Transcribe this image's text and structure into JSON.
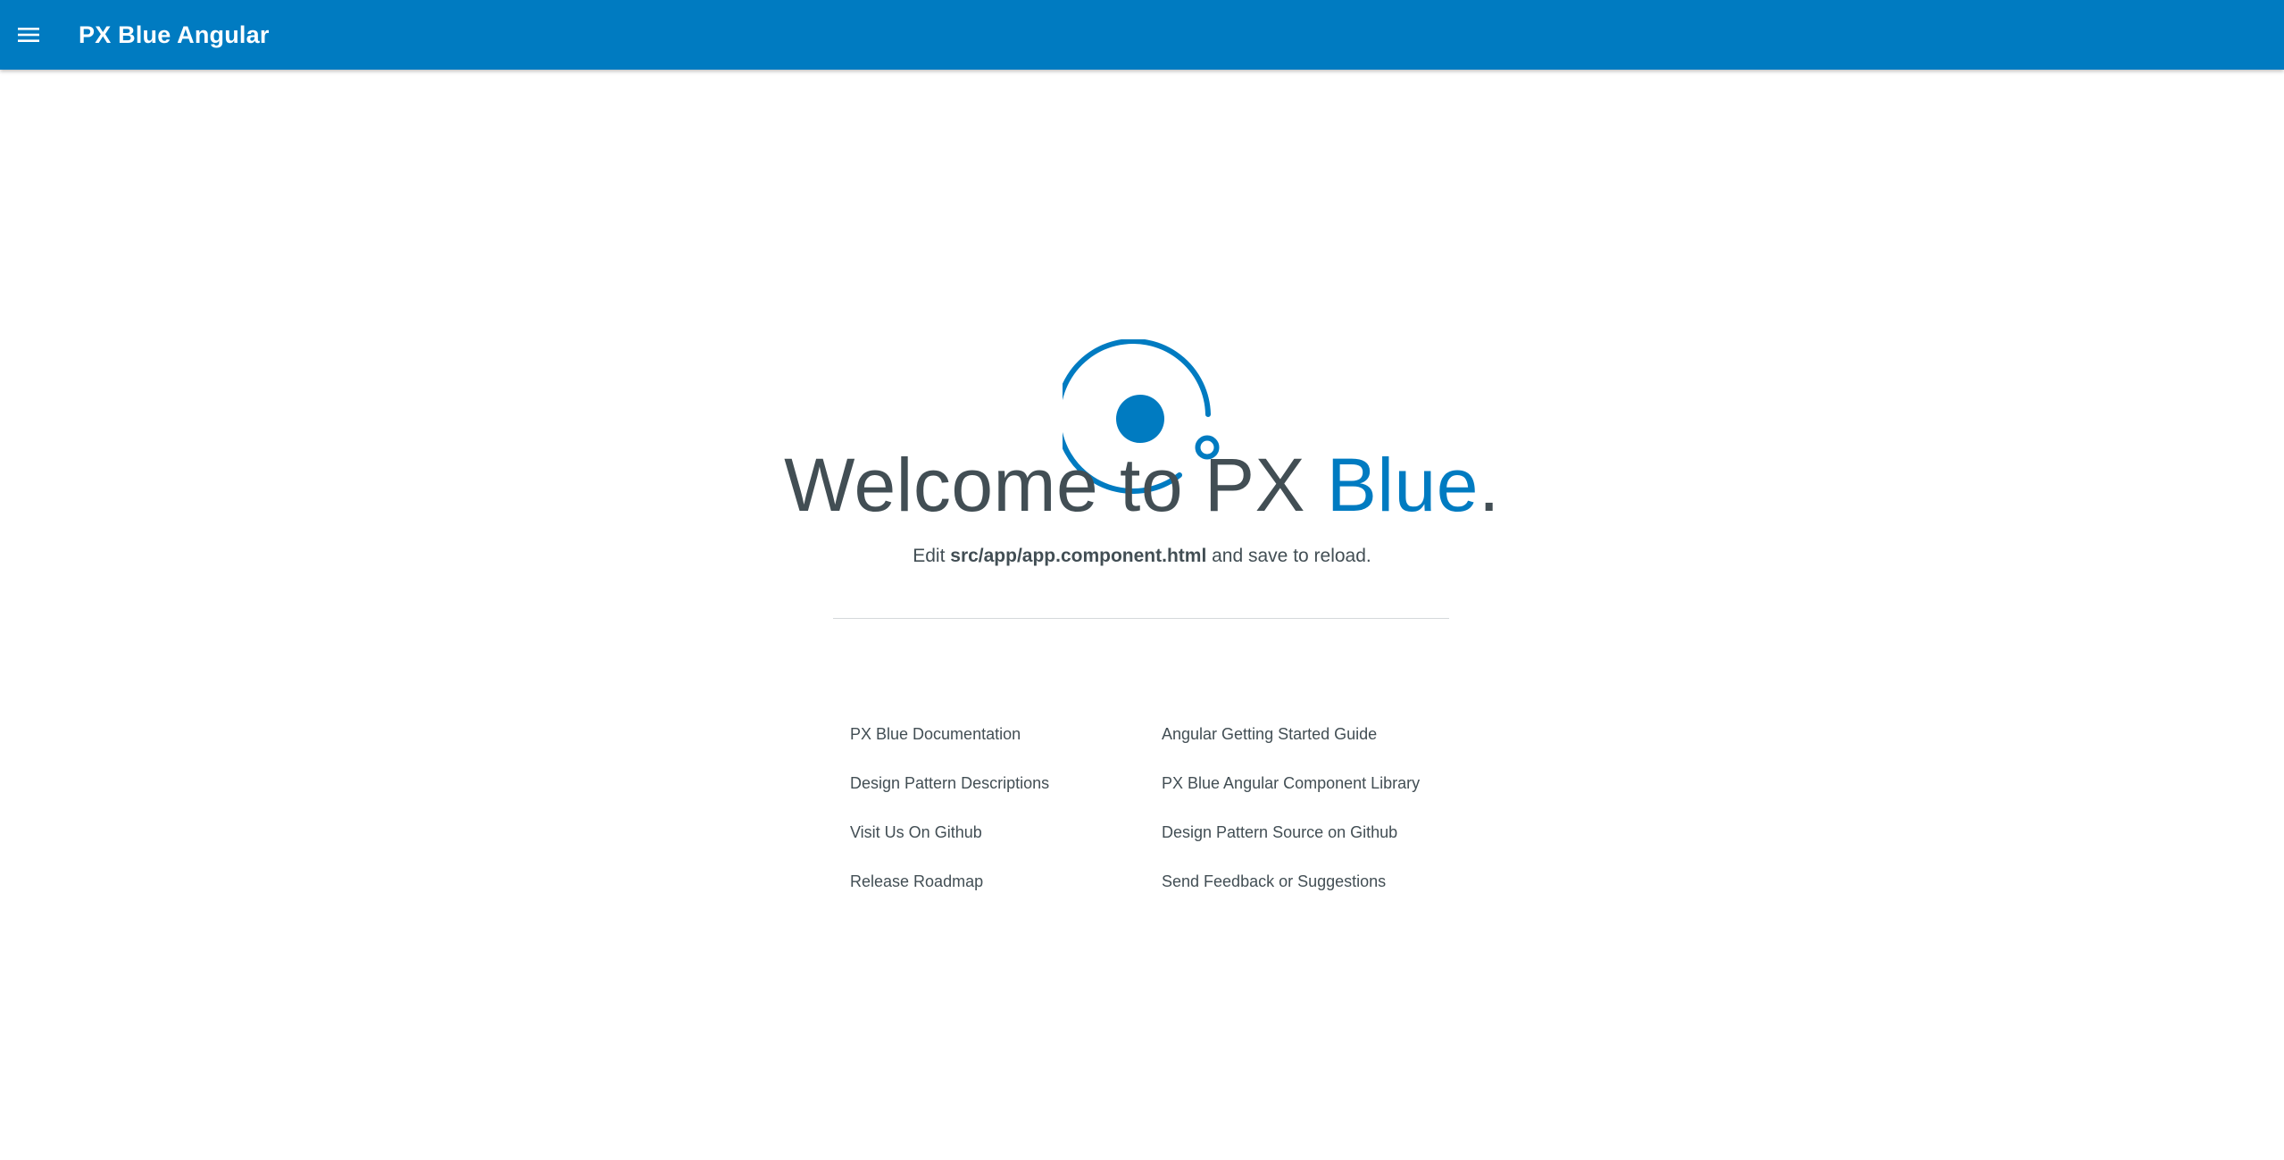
{
  "toolbar": {
    "menu_icon": "menu-icon",
    "title": "PX Blue Angular",
    "color": "#007bc1"
  },
  "hero": {
    "logo_icon": "px-blue-logo-icon",
    "welcome_prefix": "Welcome to PX ",
    "welcome_highlight": "Blue",
    "welcome_suffix": ".",
    "subtitle_prefix": "Edit ",
    "subtitle_file": "src/app/app.component.html",
    "subtitle_suffix": " and save to reload."
  },
  "links": {
    "left": [
      "PX Blue Documentation",
      "Design Pattern Descriptions",
      "Visit Us On Github",
      "Release Roadmap"
    ],
    "right": [
      "Angular Getting Started Guide",
      "PX Blue Angular Component Library",
      "Design Pattern Source on Github",
      "Send Feedback or Suggestions"
    ]
  },
  "colors": {
    "primary": "#007bc1",
    "text": "#424e54",
    "divider": "#d5d8da"
  }
}
